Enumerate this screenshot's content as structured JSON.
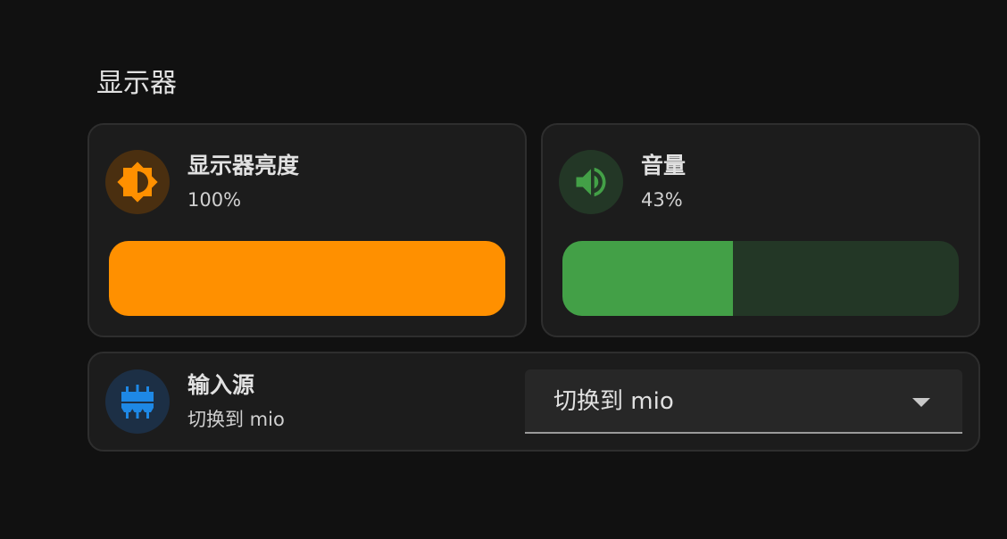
{
  "section": {
    "title": "显示器"
  },
  "brightness": {
    "name": "显示器亮度",
    "state": "100%",
    "level": 1.0,
    "icon": "brightness-icon",
    "color": "#ff9000",
    "icon_bg": "#4a2f10",
    "track_color": "#4a2f10"
  },
  "volume": {
    "name": "音量",
    "state": "43%",
    "level": 0.43,
    "icon": "speaker-icon",
    "color": "#43a047",
    "icon_bg": "#233726",
    "track_color": "#233726"
  },
  "input_source": {
    "name": "输入源",
    "state": "切换到 mio",
    "icon": "input-mixer-icon",
    "color": "#1e88e5",
    "icon_bg": "#1c2f45",
    "select": {
      "value": "切换到 mio"
    }
  }
}
